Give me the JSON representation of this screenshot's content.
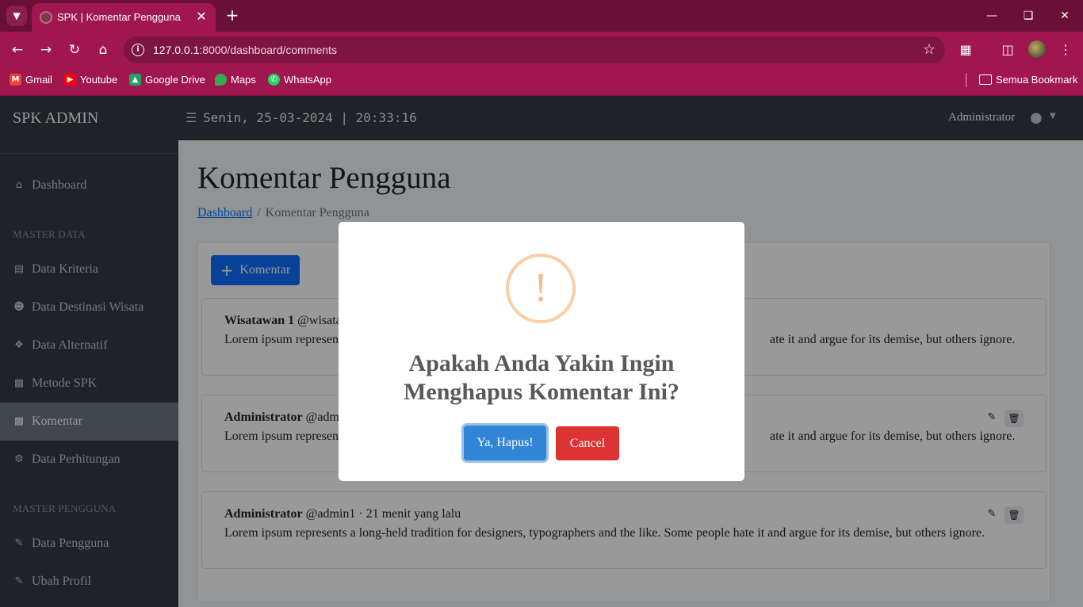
{
  "browser": {
    "tab_title": "SPK | Komentar Pengguna",
    "url_host": "127.0.0.1",
    "url_rest": ":8000/dashboard/comments",
    "bookmarks": [
      {
        "label": "Gmail",
        "icon": "gmail-icon",
        "color": "#ea4335"
      },
      {
        "label": "Youtube",
        "icon": "youtube-icon",
        "color": "#ff0000"
      },
      {
        "label": "Google Drive",
        "icon": "google-drive-icon",
        "color": "#1fa463"
      },
      {
        "label": "Maps",
        "icon": "maps-icon",
        "color": "#34a853"
      },
      {
        "label": "WhatsApp",
        "icon": "whatsapp-icon",
        "color": "#25d366"
      }
    ],
    "all_bookmarks": "Semua Bookmark"
  },
  "sidebar": {
    "brand": "SPK ADMIN",
    "items": [
      {
        "label": "Dashboard",
        "icon": "home-icon"
      },
      {
        "label": "Data Kriteria",
        "icon": "table-icon"
      },
      {
        "label": "Data Destinasi Wisata",
        "icon": "users-icon"
      },
      {
        "label": "Data Alternatif",
        "icon": "cubes-icon"
      },
      {
        "label": "Metode SPK",
        "icon": "sitemap-icon"
      },
      {
        "label": "Komentar",
        "icon": "sitemap-icon"
      },
      {
        "label": "Data Perhitungan",
        "icon": "gear-icon"
      },
      {
        "label": "Data Pengguna",
        "icon": "user-edit-icon"
      },
      {
        "label": "Ubah Profil",
        "icon": "user-edit-icon"
      }
    ],
    "headers": [
      "MASTER DATA",
      "MASTER PENGGUNA"
    ],
    "active": "Komentar"
  },
  "topbar": {
    "datetime": "Senin, 25-03-2024 | 20:33:16",
    "user": "Administrator"
  },
  "page": {
    "title": "Komentar Pengguna",
    "breadcrumb_link": "Dashboard",
    "breadcrumb_current": "Komentar Pengguna",
    "add_button": "Komentar"
  },
  "comments": [
    {
      "name": "Wisatawan 1",
      "handle": "@wisata",
      "time": "",
      "body_left": "Lorem ipsum represent",
      "body_right": "ate it and argue for its demise, but others ignore."
    },
    {
      "name": "Administrator",
      "handle": "@adm",
      "time": "",
      "body_left": "Lorem ipsum represen",
      "body_right": "ate it and argue for its demise, but others ignore."
    },
    {
      "name": "Administrator",
      "handle": "@admin1 · 21 menit yang lalu",
      "time": "",
      "body_left": "Lorem ipsum represents a long-held tradition for designers, typographers and the like. Some people hate it and argue for its demise, but others ignore.",
      "body_right": ""
    }
  ],
  "modal": {
    "icon": "!",
    "title": "Apakah Anda Yakin Ingin Menghapus Komentar Ini?",
    "confirm": "Ya, Hapus!",
    "cancel": "Cancel"
  },
  "colors": {
    "confirm": "#3085d6",
    "cancel": "#dd3333",
    "warning": "#f8bb86",
    "browser_accent": "#a0174f"
  }
}
